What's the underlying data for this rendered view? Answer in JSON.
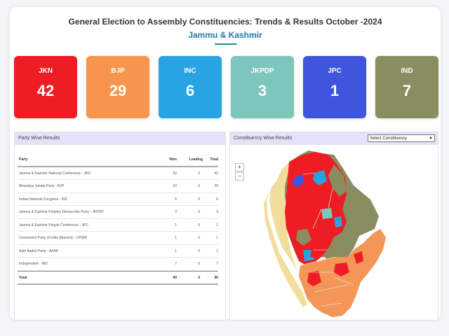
{
  "header": {
    "title": "General Election to Assembly Constituencies: Trends & Results October -2024",
    "state": "Jammu & Kashmir"
  },
  "summary_cards": [
    {
      "party": "JKN",
      "seats": "42",
      "color": "#ee1d23"
    },
    {
      "party": "BJP",
      "seats": "29",
      "color": "#f7954c"
    },
    {
      "party": "INC",
      "seats": "6",
      "color": "#28a3e3"
    },
    {
      "party": "JKPDP",
      "seats": "3",
      "color": "#7cc6bb"
    },
    {
      "party": "JPC",
      "seats": "1",
      "color": "#3f55dd"
    },
    {
      "party": "IND",
      "seats": "7",
      "color": "#8a8d5f"
    }
  ],
  "party_panel": {
    "title": "Party Wise Results",
    "columns": {
      "party": "Party",
      "won": "Won",
      "leading": "Leading",
      "total": "Total"
    },
    "rows": [
      {
        "party": "Jammu & Kashmir National Conference - JKN",
        "won": "42",
        "leading": "0",
        "total": "42"
      },
      {
        "party": "Bharatiya Janata Party - BJP",
        "won": "29",
        "leading": "0",
        "total": "29"
      },
      {
        "party": "Indian National Congress - INC",
        "won": "6",
        "leading": "0",
        "total": "6"
      },
      {
        "party": "Jammu & Kashmir Peoples Democratic Party - JKPDP",
        "won": "3",
        "leading": "0",
        "total": "3"
      },
      {
        "party": "Jammu & Kashmir People Conference - JPC",
        "won": "1",
        "leading": "0",
        "total": "1"
      },
      {
        "party": "Communist Party of India (Marxist) - CPI(M)",
        "won": "1",
        "leading": "0",
        "total": "1"
      },
      {
        "party": "Aam Aadmi Party - AAAP",
        "won": "1",
        "leading": "0",
        "total": "1"
      },
      {
        "party": "Independent - IND",
        "won": "7",
        "leading": "0",
        "total": "7"
      }
    ],
    "total": {
      "label": "Total",
      "won": "90",
      "leading": "0",
      "total": "90"
    }
  },
  "constituency_panel": {
    "title": "Constituency Wise Results",
    "select_value": "Select Constituency",
    "zoom_in": "+",
    "zoom_out": "−"
  },
  "map_colors": {
    "ladakh": "#f2dd9a",
    "jkn": "#ee1d23",
    "bjp": "#f39657",
    "inc": "#2aa2e2",
    "ind": "#8a8d5f",
    "jpc": "#3f55dd",
    "jkpdp": "#7cc6bb"
  }
}
